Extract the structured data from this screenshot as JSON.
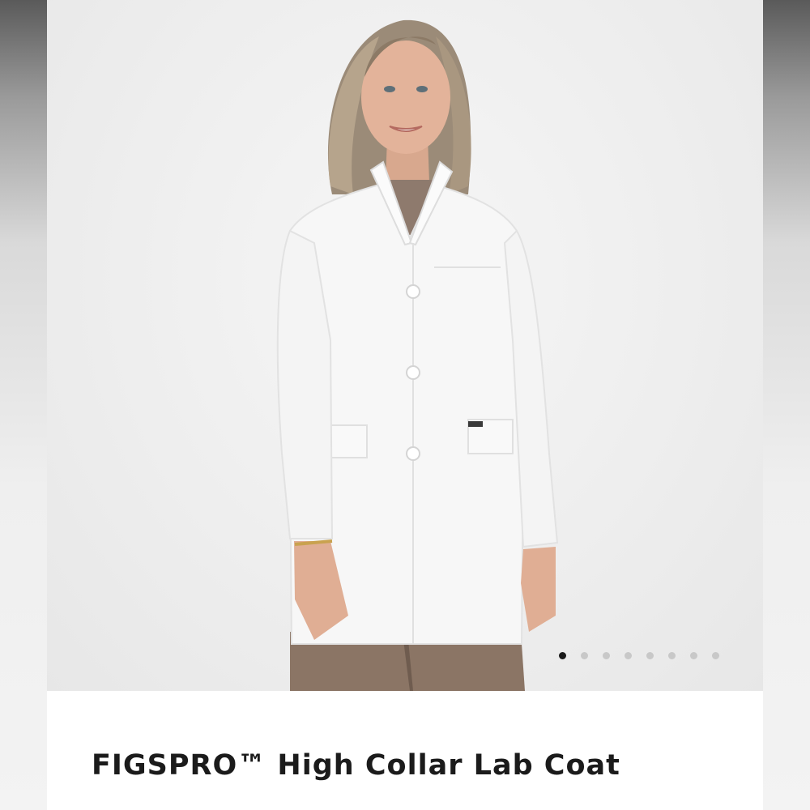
{
  "product": {
    "title": "FIGSPRO™ High Collar Lab Coat"
  },
  "gallery": {
    "image_count": 8,
    "active_index": 0
  },
  "colors": {
    "coat": "#f7f7f7",
    "pants": "#8b7565",
    "background": "#eeeeee",
    "active_dot": "#1a1a1a",
    "inactive_dot": "#c8c8c8"
  }
}
